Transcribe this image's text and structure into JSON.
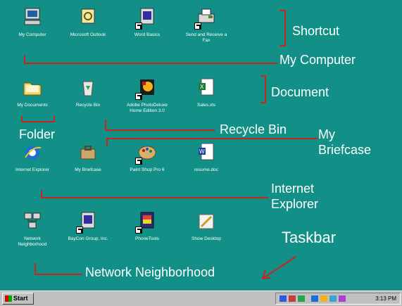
{
  "desktop": {
    "icons": [
      {
        "label": "My Computer"
      },
      {
        "label": "Microsoft Outlook"
      },
      {
        "label": "Word Basics"
      },
      {
        "label": "Send and Receive a\nFax"
      },
      {
        "label": "My Documents"
      },
      {
        "label": "Recycle Bin"
      },
      {
        "label": "Adobe PhotoDeluxe\nHome Edition 3.0"
      },
      {
        "label": "Sales.xls"
      },
      {
        "label": "Internet Explorer"
      },
      {
        "label": "My Briefcase"
      },
      {
        "label": "Paint Shop Pro 6"
      },
      {
        "label": "resume.doc"
      },
      {
        "label": "Network\nNeighborhood"
      },
      {
        "label": "BayCon Group, Inc."
      },
      {
        "label": "PhoneTools"
      },
      {
        "label": "Show Desktop"
      }
    ],
    "annotations": {
      "shortcut": "Shortcut",
      "my_computer": "My Computer",
      "document": "Document",
      "recycle_bin": "Recycle Bin",
      "folder": "Folder",
      "my_briefcase": "My\nBriefcase",
      "internet_explorer": "Internet\nExplorer",
      "taskbar": "Taskbar",
      "network_neighborhood": "Network Neighborhood"
    }
  },
  "taskbar": {
    "start_label": "Start",
    "clock": "3:13 PM"
  },
  "colors": {
    "desktop": "#128f86",
    "annotation_line": "#c8251e",
    "taskbar": "#c0c0c0"
  }
}
